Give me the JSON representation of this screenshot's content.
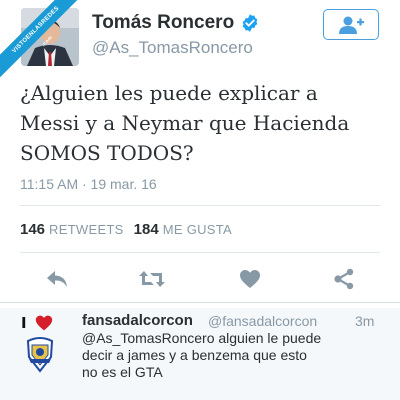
{
  "watermark": {
    "line1": "VISTOENLASREDES",
    "line2": ".com"
  },
  "author": {
    "name": "Tomás Roncero",
    "handle": "@As_TomasRoncero",
    "verified": true,
    "follow_icon": "add-user-icon"
  },
  "tweet": {
    "text": "¿Alguien les puede explicar a\nMessi y a Neymar que Hacienda\nSOMOS TODOS?",
    "timestamp": "11:15 AM · 19 mar. 16",
    "retweets_count": "146",
    "retweets_label": "RETWEETS",
    "likes_count": "184",
    "likes_label": "ME GUSTA"
  },
  "actions": [
    "reply-icon",
    "retweet-icon",
    "like-icon",
    "share-icon"
  ],
  "reply": {
    "prefix": "I",
    "name": "fansadalcorcon",
    "handle": "@fansadalcorcon",
    "time": "3m",
    "text": "@As_TomasRoncero alguien le puede\ndecir a james y a benzema que esto\nno es el GTA"
  },
  "colors": {
    "accent": "#1da1f2",
    "muted": "#8899a6",
    "text": "#292f33",
    "heart": "#e0245e"
  }
}
